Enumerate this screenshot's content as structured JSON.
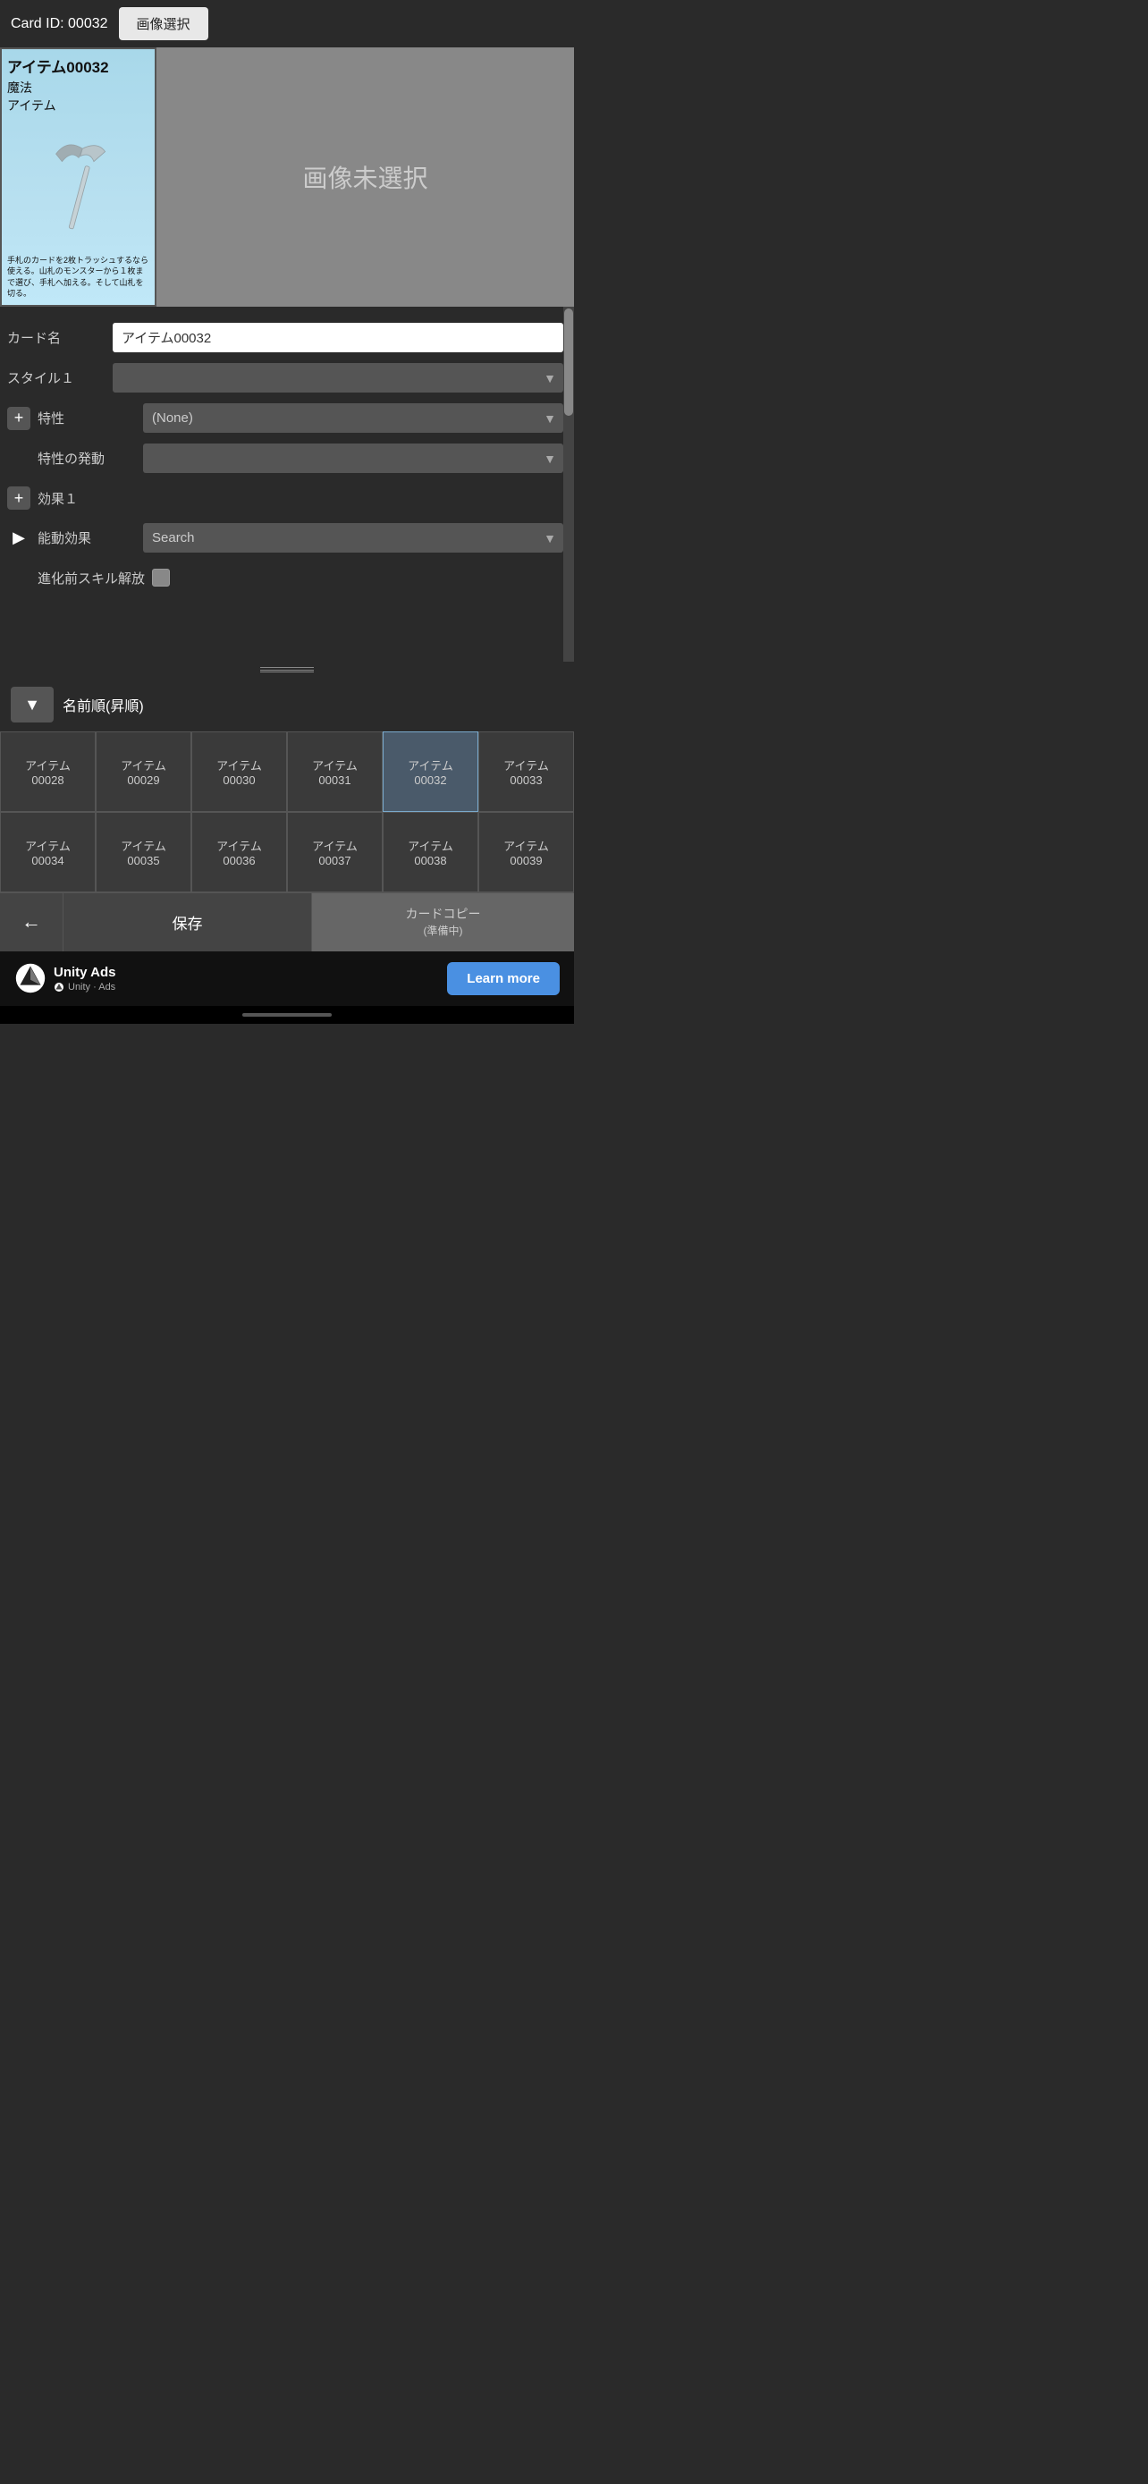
{
  "header": {
    "card_id_label": "Card ID: 00032",
    "image_select_btn": "画像選択"
  },
  "card": {
    "title": "アイテム00032",
    "type1": "魔法",
    "type2": "アイテム",
    "description": "手札のカードを2枚トラッシュするなら使える。山札のモンスターから１枚まで選び、手札へ加える。そして山札を切る。",
    "no_image_text": "画像未選択"
  },
  "form": {
    "card_name_label": "カード名",
    "card_name_value": "アイテム00032",
    "style1_label": "スタイル１",
    "style1_placeholder": "",
    "trait_label": "特性",
    "trait_value": "(None)",
    "trait_trigger_label": "特性の発動",
    "effect1_label": "効果１",
    "passive_label": "能動効果",
    "passive_placeholder": "Search",
    "evolve_label": "進化前スキル解放"
  },
  "sort": {
    "sort_label": "名前順(昇順)"
  },
  "grid": {
    "items": [
      {
        "id": "アイテム\n00028",
        "selected": false
      },
      {
        "id": "アイテム\n00029",
        "selected": false
      },
      {
        "id": "アイテム\n00030",
        "selected": false
      },
      {
        "id": "アイテム\n00031",
        "selected": false
      },
      {
        "id": "アイテム\n00032",
        "selected": true
      },
      {
        "id": "アイテム\n00033",
        "selected": false
      },
      {
        "id": "アイテム\n00034",
        "selected": false
      },
      {
        "id": "アイテム\n00035",
        "selected": false
      },
      {
        "id": "アイテム\n00036",
        "selected": false
      },
      {
        "id": "アイテム\n00037",
        "selected": false
      },
      {
        "id": "アイテム\n00038",
        "selected": false
      },
      {
        "id": "アイテム\n00039",
        "selected": false
      }
    ]
  },
  "buttons": {
    "back_label": "←",
    "save_label": "保存",
    "copy_label": "カードコピー\n(準備中)"
  },
  "ads": {
    "brand": "Unity Ads",
    "sub_label": "Unity · Ads",
    "learn_more": "Learn more"
  }
}
